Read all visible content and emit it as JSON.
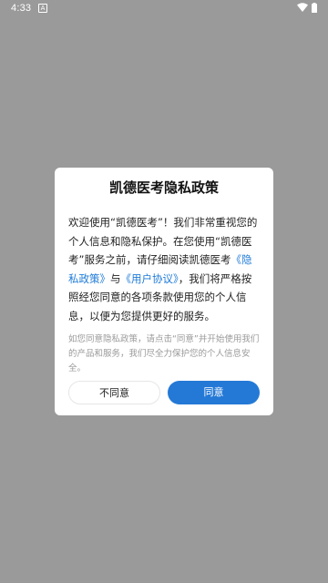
{
  "status_bar": {
    "time": "4:33",
    "notification_icon_glyph": "A",
    "icons": [
      "notification-a-icon",
      "wifi-icon",
      "battery-icon"
    ]
  },
  "dialog": {
    "title": "凯德医考隐私政策",
    "body": {
      "part1": "欢迎使用“凯德医考”！我们非常重视您的个人信息和隐私保护。在您使用“凯德医考”服务之前，请仔细阅读凯德医考",
      "privacy_link": "《隐私政策》",
      "and_text": "与",
      "user_agreement_link": "《用户协议》",
      "part2": "，我们将严格按照经您同意的各项条款使用您的个人信息，以便为您提供更好的服务。"
    },
    "note": "如您同意隐私政策，请点击“同意”并开始使用我们的产品和服务，我们尽全力保护您的个人信息安全。",
    "disagree_label": "不同意",
    "agree_label": "同意"
  },
  "colors": {
    "accent": "#2479d6",
    "link": "#1e7bd8",
    "backdrop": "#9a9a9a"
  }
}
